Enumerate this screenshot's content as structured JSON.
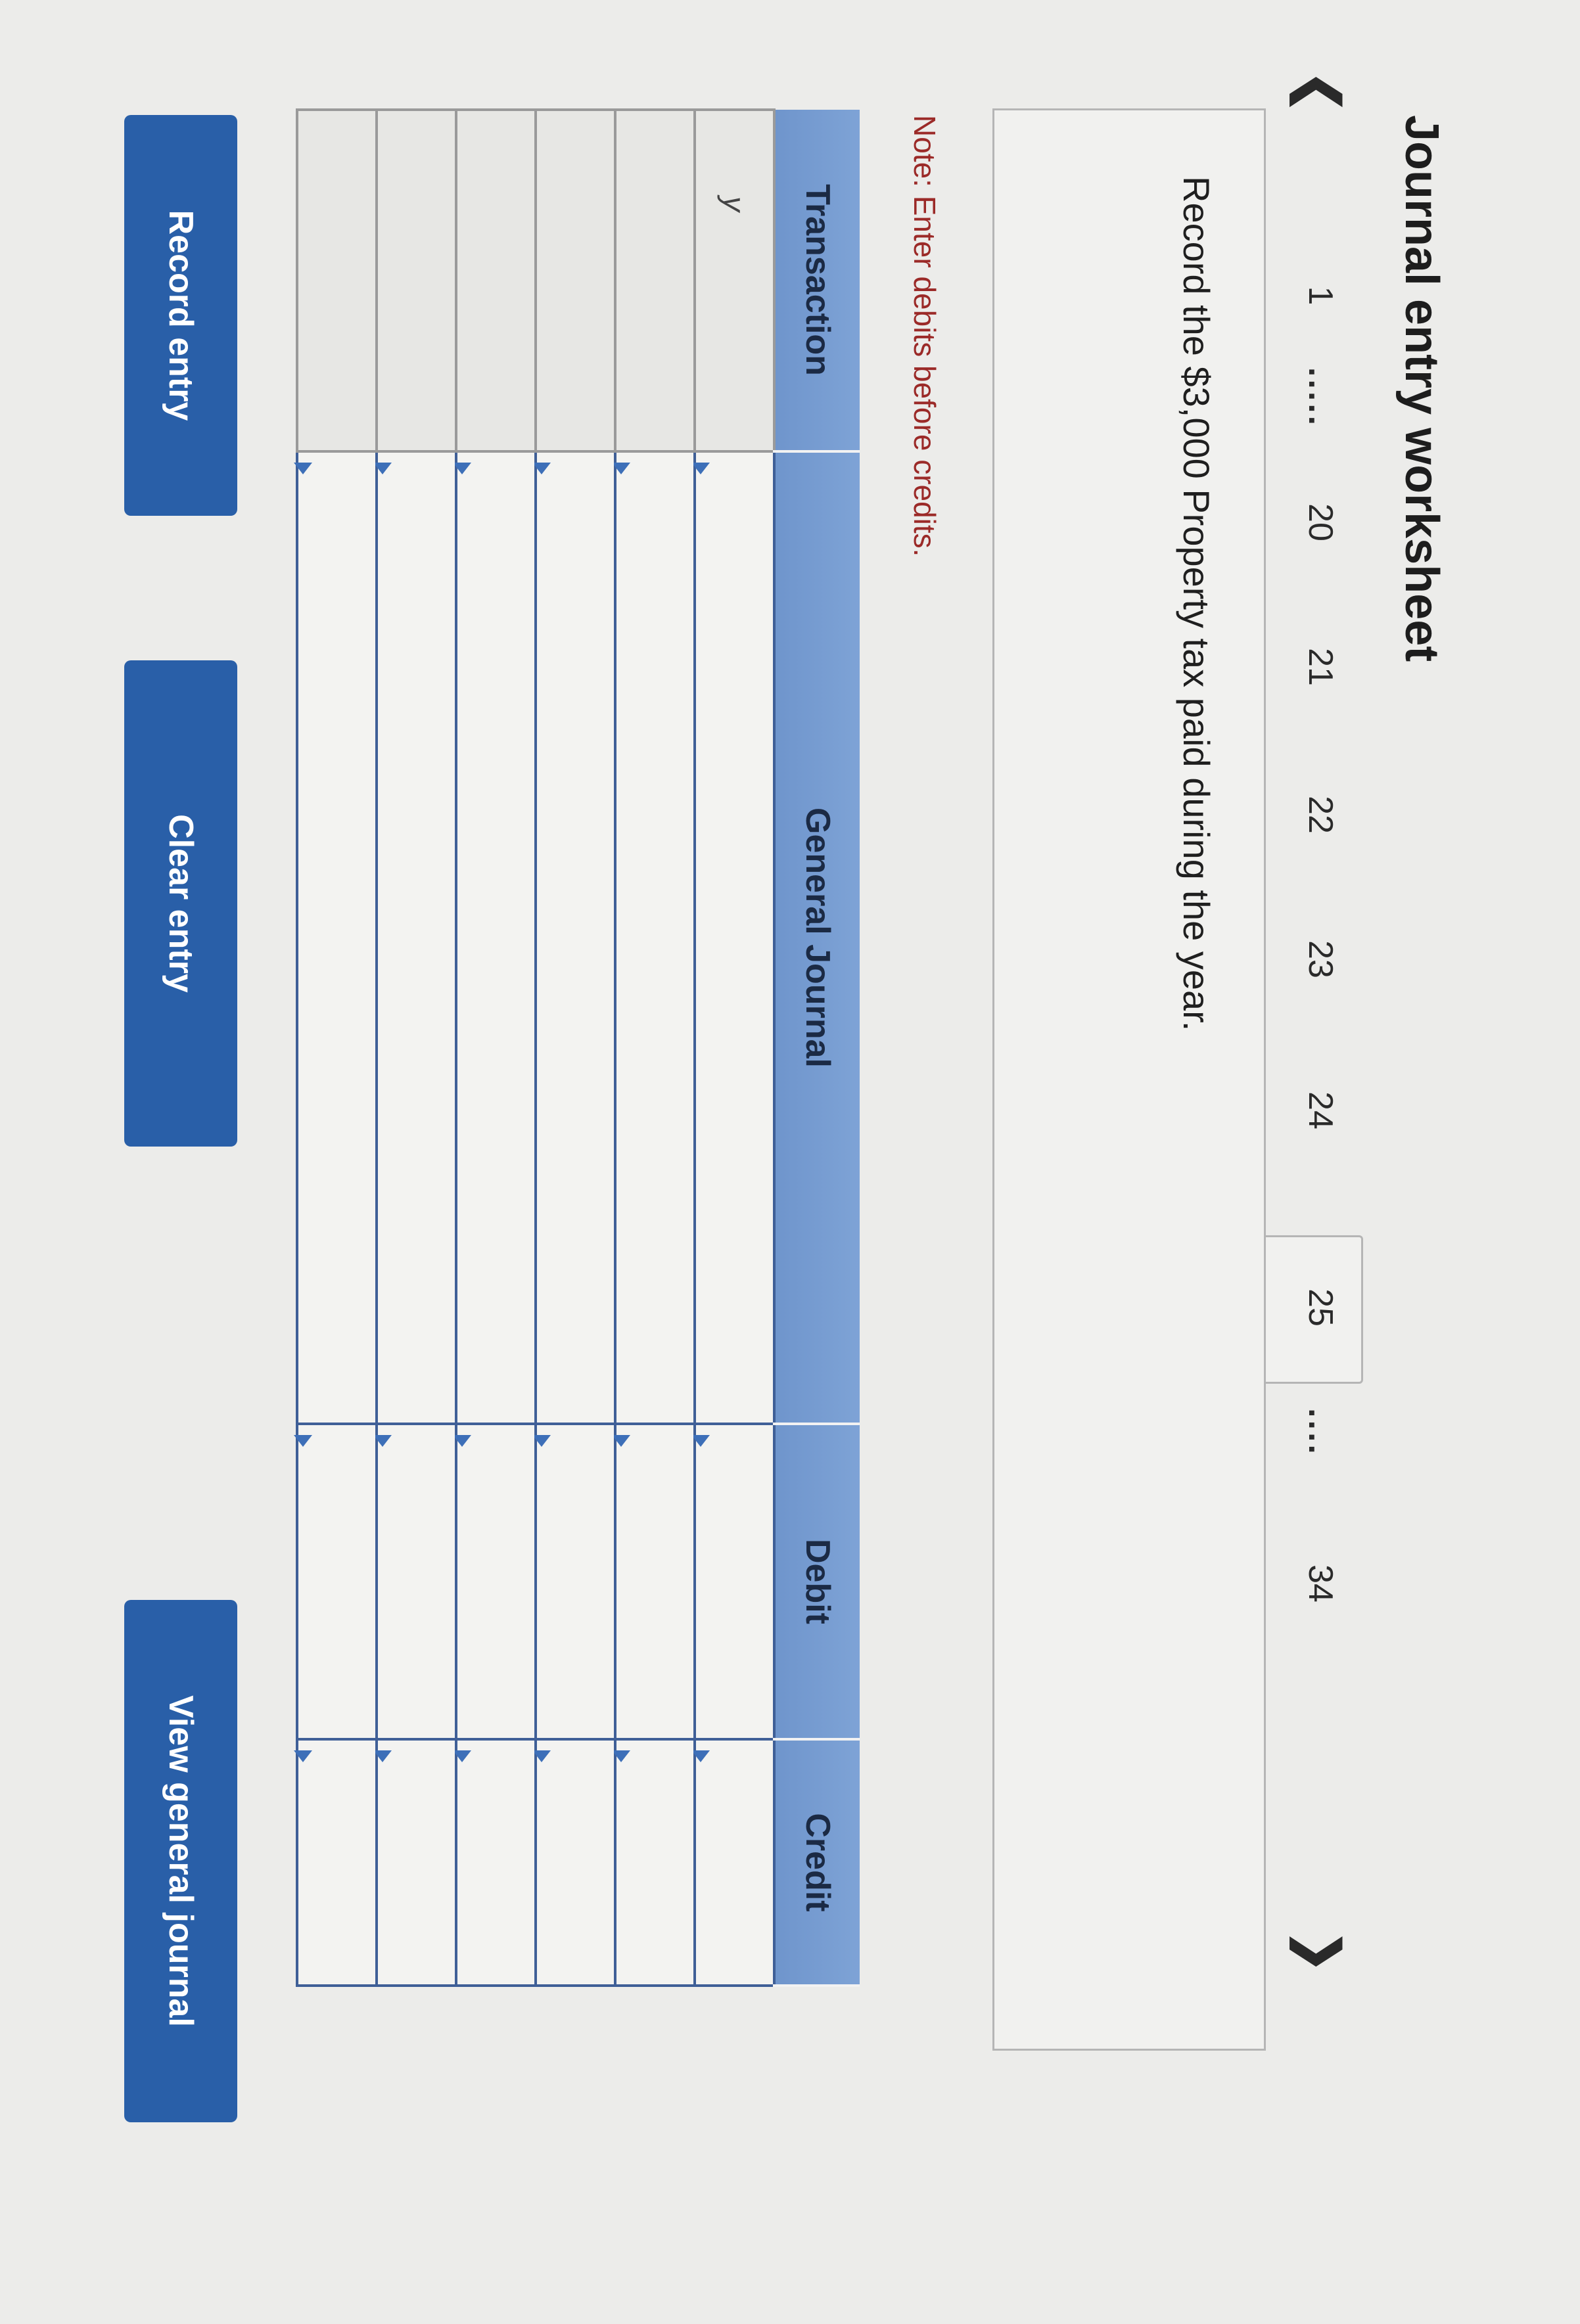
{
  "title": "Journal entry worksheet",
  "pager": {
    "prev_icon": "chevron-left-icon",
    "next_icon": "chevron-right-icon",
    "items": [
      "1",
      ".....",
      "20",
      "21",
      "22",
      "23",
      "24",
      "25",
      "....",
      "34"
    ],
    "active": "25"
  },
  "prompt": "Record the $3,000 Property tax paid during the year.",
  "note": "Note: Enter debits before credits.",
  "table": {
    "headers": [
      "Transaction",
      "General Journal",
      "Debit",
      "Credit"
    ],
    "rows": [
      {
        "transaction": "y",
        "account": "",
        "debit": "",
        "credit": ""
      },
      {
        "transaction": "",
        "account": "",
        "debit": "",
        "credit": ""
      },
      {
        "transaction": "",
        "account": "",
        "debit": "",
        "credit": ""
      },
      {
        "transaction": "",
        "account": "",
        "debit": "",
        "credit": ""
      },
      {
        "transaction": "",
        "account": "",
        "debit": "",
        "credit": ""
      },
      {
        "transaction": "",
        "account": "",
        "debit": "",
        "credit": ""
      }
    ]
  },
  "buttons": {
    "record": "Record entry",
    "clear": "Clear entry",
    "view": "View general journal"
  },
  "colors": {
    "header_bg": "#6f95cc",
    "button_bg": "#295fa8",
    "note_text": "#9b2a28",
    "grid_line": "#3f5f97"
  }
}
